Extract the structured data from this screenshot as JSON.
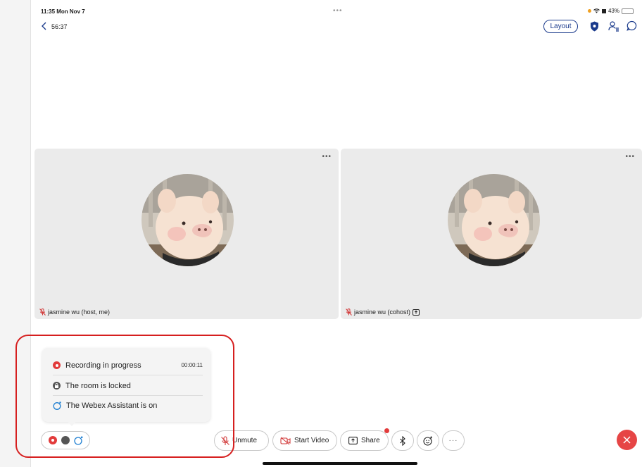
{
  "status_bar": {
    "time": "11:35  Mon Nov 7",
    "battery": "43%"
  },
  "header": {
    "timer": "56:37",
    "layout_label": "Layout"
  },
  "tiles": [
    {
      "name": "jasmine wu (host, me)"
    },
    {
      "name": "jasmine wu (cohost)"
    }
  ],
  "popover": {
    "recording_label": "Recording in progress",
    "recording_time": "00:00:11",
    "locked_label": "The room is locked",
    "assistant_label": "The Webex Assistant is on"
  },
  "controls": {
    "unmute_label": "Unmute",
    "start_video_label": "Start Video",
    "share_label": "Share"
  },
  "colors": {
    "accent": "#1a3a8c",
    "record_red": "#e23b3b",
    "leave_red": "#e64545",
    "tile_bg": "#ebebeb"
  }
}
